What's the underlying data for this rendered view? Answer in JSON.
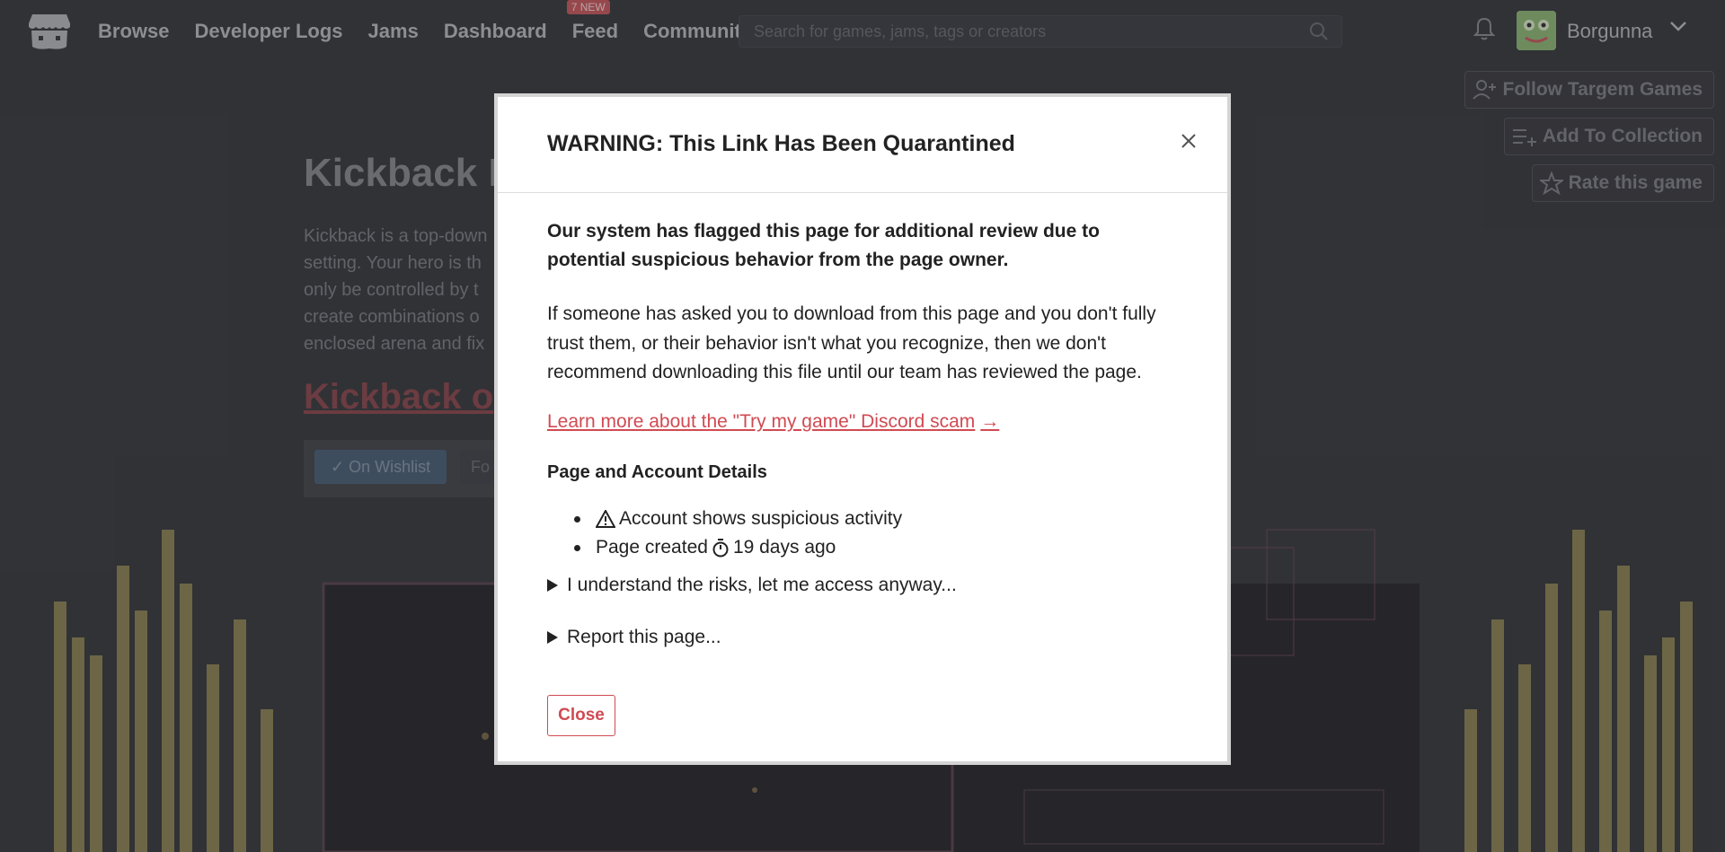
{
  "nav": {
    "items": [
      "Browse",
      "Developer Logs",
      "Jams",
      "Dashboard",
      "Feed",
      "Community"
    ],
    "feed_badge": "7 NEW",
    "search_placeholder": "Search for games, jams, tags or creators",
    "username": "Borgunna"
  },
  "page": {
    "title": "Kickback D",
    "description": "Kickback is a top-down setting. Your hero is th only be controlled by t create combinations o enclosed arena and fix",
    "download_link": "Kickback o",
    "wishlist_label": "On Wishlist",
    "follow_partial": "Fo",
    "side_buttons": {
      "follow": "Follow Targem Games",
      "collection": "Add To Collection",
      "rate": "Rate this game"
    }
  },
  "modal": {
    "title": "WARNING: This Link Has Been Quarantined",
    "intro": "Our system has flagged this page for additional review due to potential suspicious behavior from the page owner.",
    "body": "If someone has asked you to download from this page and you don't fully trust them, or their behavior isn't what you recognize, then we don't recommend downloading this file until our team has reviewed the page.",
    "learn_more": "Learn more about the \"Try my game\" Discord scam",
    "learn_arrow": "→",
    "details_heading": "Page and Account Details",
    "detail_suspicious": "Account shows suspicious activity",
    "detail_created_prefix": "Page created",
    "detail_created_age": "19 days ago",
    "access_anyway": "I understand the risks, let me access anyway...",
    "report": "Report this page...",
    "close_label": "Close"
  },
  "colors": {
    "accent": "#d14a52",
    "nav_bg": "#3a3c41",
    "modal_bg": "#ffffff"
  }
}
